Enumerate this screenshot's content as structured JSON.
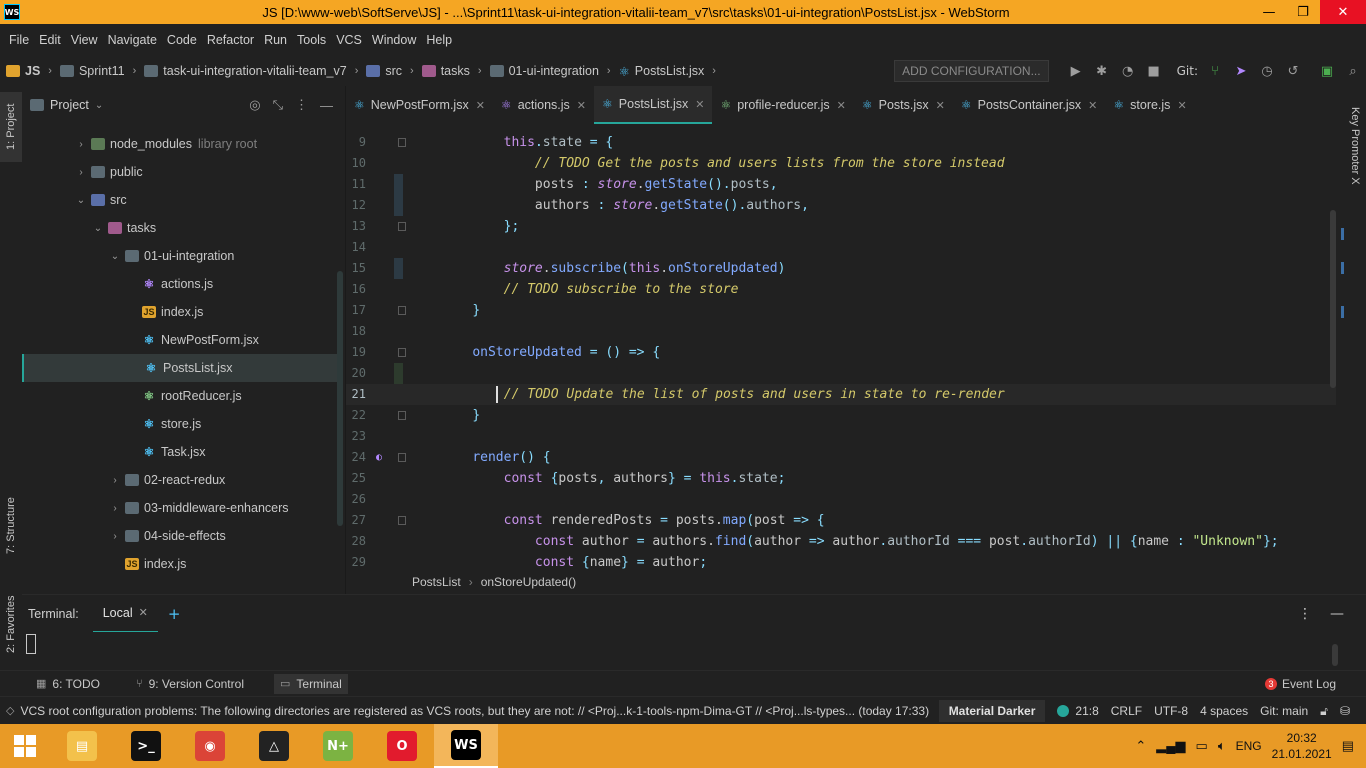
{
  "window": {
    "title": "JS [D:\\www-web\\SoftServe\\JS] - ...\\Sprint11\\task-ui-integration-vitalii-team_v7\\src\\tasks\\01-ui-integration\\PostsList.jsx - WebStorm",
    "logo": "WS",
    "minimize": "—",
    "restore": "❐",
    "close": "✕"
  },
  "menu": [
    "File",
    "Edit",
    "View",
    "Navigate",
    "Code",
    "Refactor",
    "Run",
    "Tools",
    "VCS",
    "Window",
    "Help"
  ],
  "breadcrumb": [
    "JS",
    "Sprint11",
    "task-ui-integration-vitalii-team_v7",
    "src",
    "tasks",
    "01-ui-integration",
    "PostsList.jsx"
  ],
  "nav": {
    "add_config": "ADD CONFIGURATION...",
    "git_label": "Git:"
  },
  "left_tabs": {
    "project": "1: Project",
    "structure": "7: Structure",
    "favorites": "2: Favorites"
  },
  "right_tabs": {
    "key_promoter": "Key Promoter X"
  },
  "project": {
    "title": "Project",
    "tree": [
      {
        "label": "node_modules",
        "suffix": "library root",
        "icon": "folder-green",
        "arrow": "›",
        "indent": 0
      },
      {
        "label": "public",
        "suffix": "",
        "icon": "folder",
        "arrow": "›",
        "indent": 0
      },
      {
        "label": "src",
        "suffix": "",
        "icon": "folder-blue",
        "arrow": "⌄",
        "indent": 0
      },
      {
        "label": "tasks",
        "suffix": "",
        "icon": "folder-pink",
        "arrow": "⌄",
        "indent": 1
      },
      {
        "label": "01-ui-integration",
        "suffix": "",
        "icon": "folder",
        "arrow": "⌄",
        "indent": 2
      },
      {
        "label": "actions.js",
        "suffix": "",
        "icon": "redux",
        "arrow": "",
        "indent": 3
      },
      {
        "label": "index.js",
        "suffix": "",
        "icon": "js",
        "arrow": "",
        "indent": 3
      },
      {
        "label": "NewPostForm.jsx",
        "suffix": "",
        "icon": "react",
        "arrow": "",
        "indent": 3
      },
      {
        "label": "PostsList.jsx",
        "suffix": "",
        "icon": "react",
        "arrow": "",
        "indent": 3,
        "selected": true
      },
      {
        "label": "rootReducer.js",
        "suffix": "",
        "icon": "reducer",
        "arrow": "",
        "indent": 3
      },
      {
        "label": "store.js",
        "suffix": "",
        "icon": "react",
        "arrow": "",
        "indent": 3
      },
      {
        "label": "Task.jsx",
        "suffix": "",
        "icon": "react",
        "arrow": "",
        "indent": 3
      },
      {
        "label": "02-react-redux",
        "suffix": "",
        "icon": "folder",
        "arrow": "›",
        "indent": 2
      },
      {
        "label": "03-middleware-enhancers",
        "suffix": "",
        "icon": "folder",
        "arrow": "›",
        "indent": 2
      },
      {
        "label": "04-side-effects",
        "suffix": "",
        "icon": "folder",
        "arrow": "›",
        "indent": 2
      },
      {
        "label": "index.js",
        "suffix": "",
        "icon": "js",
        "arrow": "",
        "indent": 2
      }
    ]
  },
  "tabs": [
    {
      "label": "NewPostForm.jsx",
      "icon": "react"
    },
    {
      "label": "actions.js",
      "icon": "redux"
    },
    {
      "label": "PostsList.jsx",
      "icon": "react",
      "active": true
    },
    {
      "label": "profile-reducer.js",
      "icon": "reducer"
    },
    {
      "label": "Posts.jsx",
      "icon": "react"
    },
    {
      "label": "PostsContainer.jsx",
      "icon": "react"
    },
    {
      "label": "store.js",
      "icon": "react"
    }
  ],
  "code_lines": [
    {
      "n": "9",
      "text": "        this.state = {"
    },
    {
      "n": "10",
      "text": "            // TODO Get the posts and users lists from the store instead"
    },
    {
      "n": "11",
      "text": "            posts : store.getState().posts,"
    },
    {
      "n": "12",
      "text": "            authors : store.getState().authors,"
    },
    {
      "n": "13",
      "text": "        };"
    },
    {
      "n": "14",
      "text": ""
    },
    {
      "n": "15",
      "text": "        store.subscribe(this.onStoreUpdated)"
    },
    {
      "n": "16",
      "text": "        // TODO subscribe to the store"
    },
    {
      "n": "17",
      "text": "    }"
    },
    {
      "n": "18",
      "text": ""
    },
    {
      "n": "19",
      "text": "    onStoreUpdated = () => {"
    },
    {
      "n": "20",
      "text": ""
    },
    {
      "n": "21",
      "text": "        // TODO Update the list of posts and users in state to re-render"
    },
    {
      "n": "22",
      "text": "    }"
    },
    {
      "n": "23",
      "text": ""
    },
    {
      "n": "24",
      "text": "    render() {"
    },
    {
      "n": "25",
      "text": "        const {posts, authors} = this.state;"
    },
    {
      "n": "26",
      "text": ""
    },
    {
      "n": "27",
      "text": "        const renderedPosts = posts.map(post => {"
    },
    {
      "n": "28",
      "text": "            const author = authors.find(author => author.authorId === post.authorId) || {name : \"Unknown\"};"
    },
    {
      "n": "29",
      "text": "            const {name} = author;"
    }
  ],
  "editor_breadcrumb": [
    "PostsList",
    "onStoreUpdated()"
  ],
  "terminal": {
    "label": "Terminal:",
    "tab": "Local",
    "close": "✕",
    "add": "+"
  },
  "tool_windows": [
    {
      "label": "6: TODO",
      "icon": "▦"
    },
    {
      "label": "9: Version Control",
      "icon": "⑂"
    },
    {
      "label": "Terminal",
      "icon": "▭",
      "active": true
    }
  ],
  "event_log": {
    "label": "Event Log",
    "count": "3"
  },
  "status": {
    "message": "VCS root configuration problems: The following directories are registered as VCS roots, but they are not: // <Proj...k-1-tools-npm-Dima-GT // <Proj...ls-types... (today 17:33)",
    "theme": "Material Darker",
    "position": "21:8",
    "line_sep": "CRLF",
    "encoding": "UTF-8",
    "indent": "4 spaces",
    "branch": "Git: main"
  },
  "taskbar": {
    "apps": [
      {
        "name": "file-explorer",
        "glyph": "▤",
        "color": "#f3c14b"
      },
      {
        "name": "cmd",
        "glyph": ">_",
        "color": "#111111"
      },
      {
        "name": "chrome",
        "glyph": "◉",
        "color": "#db4437"
      },
      {
        "name": "unknown-app",
        "glyph": "△",
        "color": "#222222"
      },
      {
        "name": "notepad-plus",
        "glyph": "N+",
        "color": "#7cb342"
      },
      {
        "name": "opera",
        "glyph": "O",
        "color": "#e21b2d"
      },
      {
        "name": "webstorm",
        "glyph": "WS",
        "color": "#000000",
        "active": true
      }
    ],
    "lang": "ENG",
    "time": "20:32",
    "date": "21.01.2021"
  }
}
